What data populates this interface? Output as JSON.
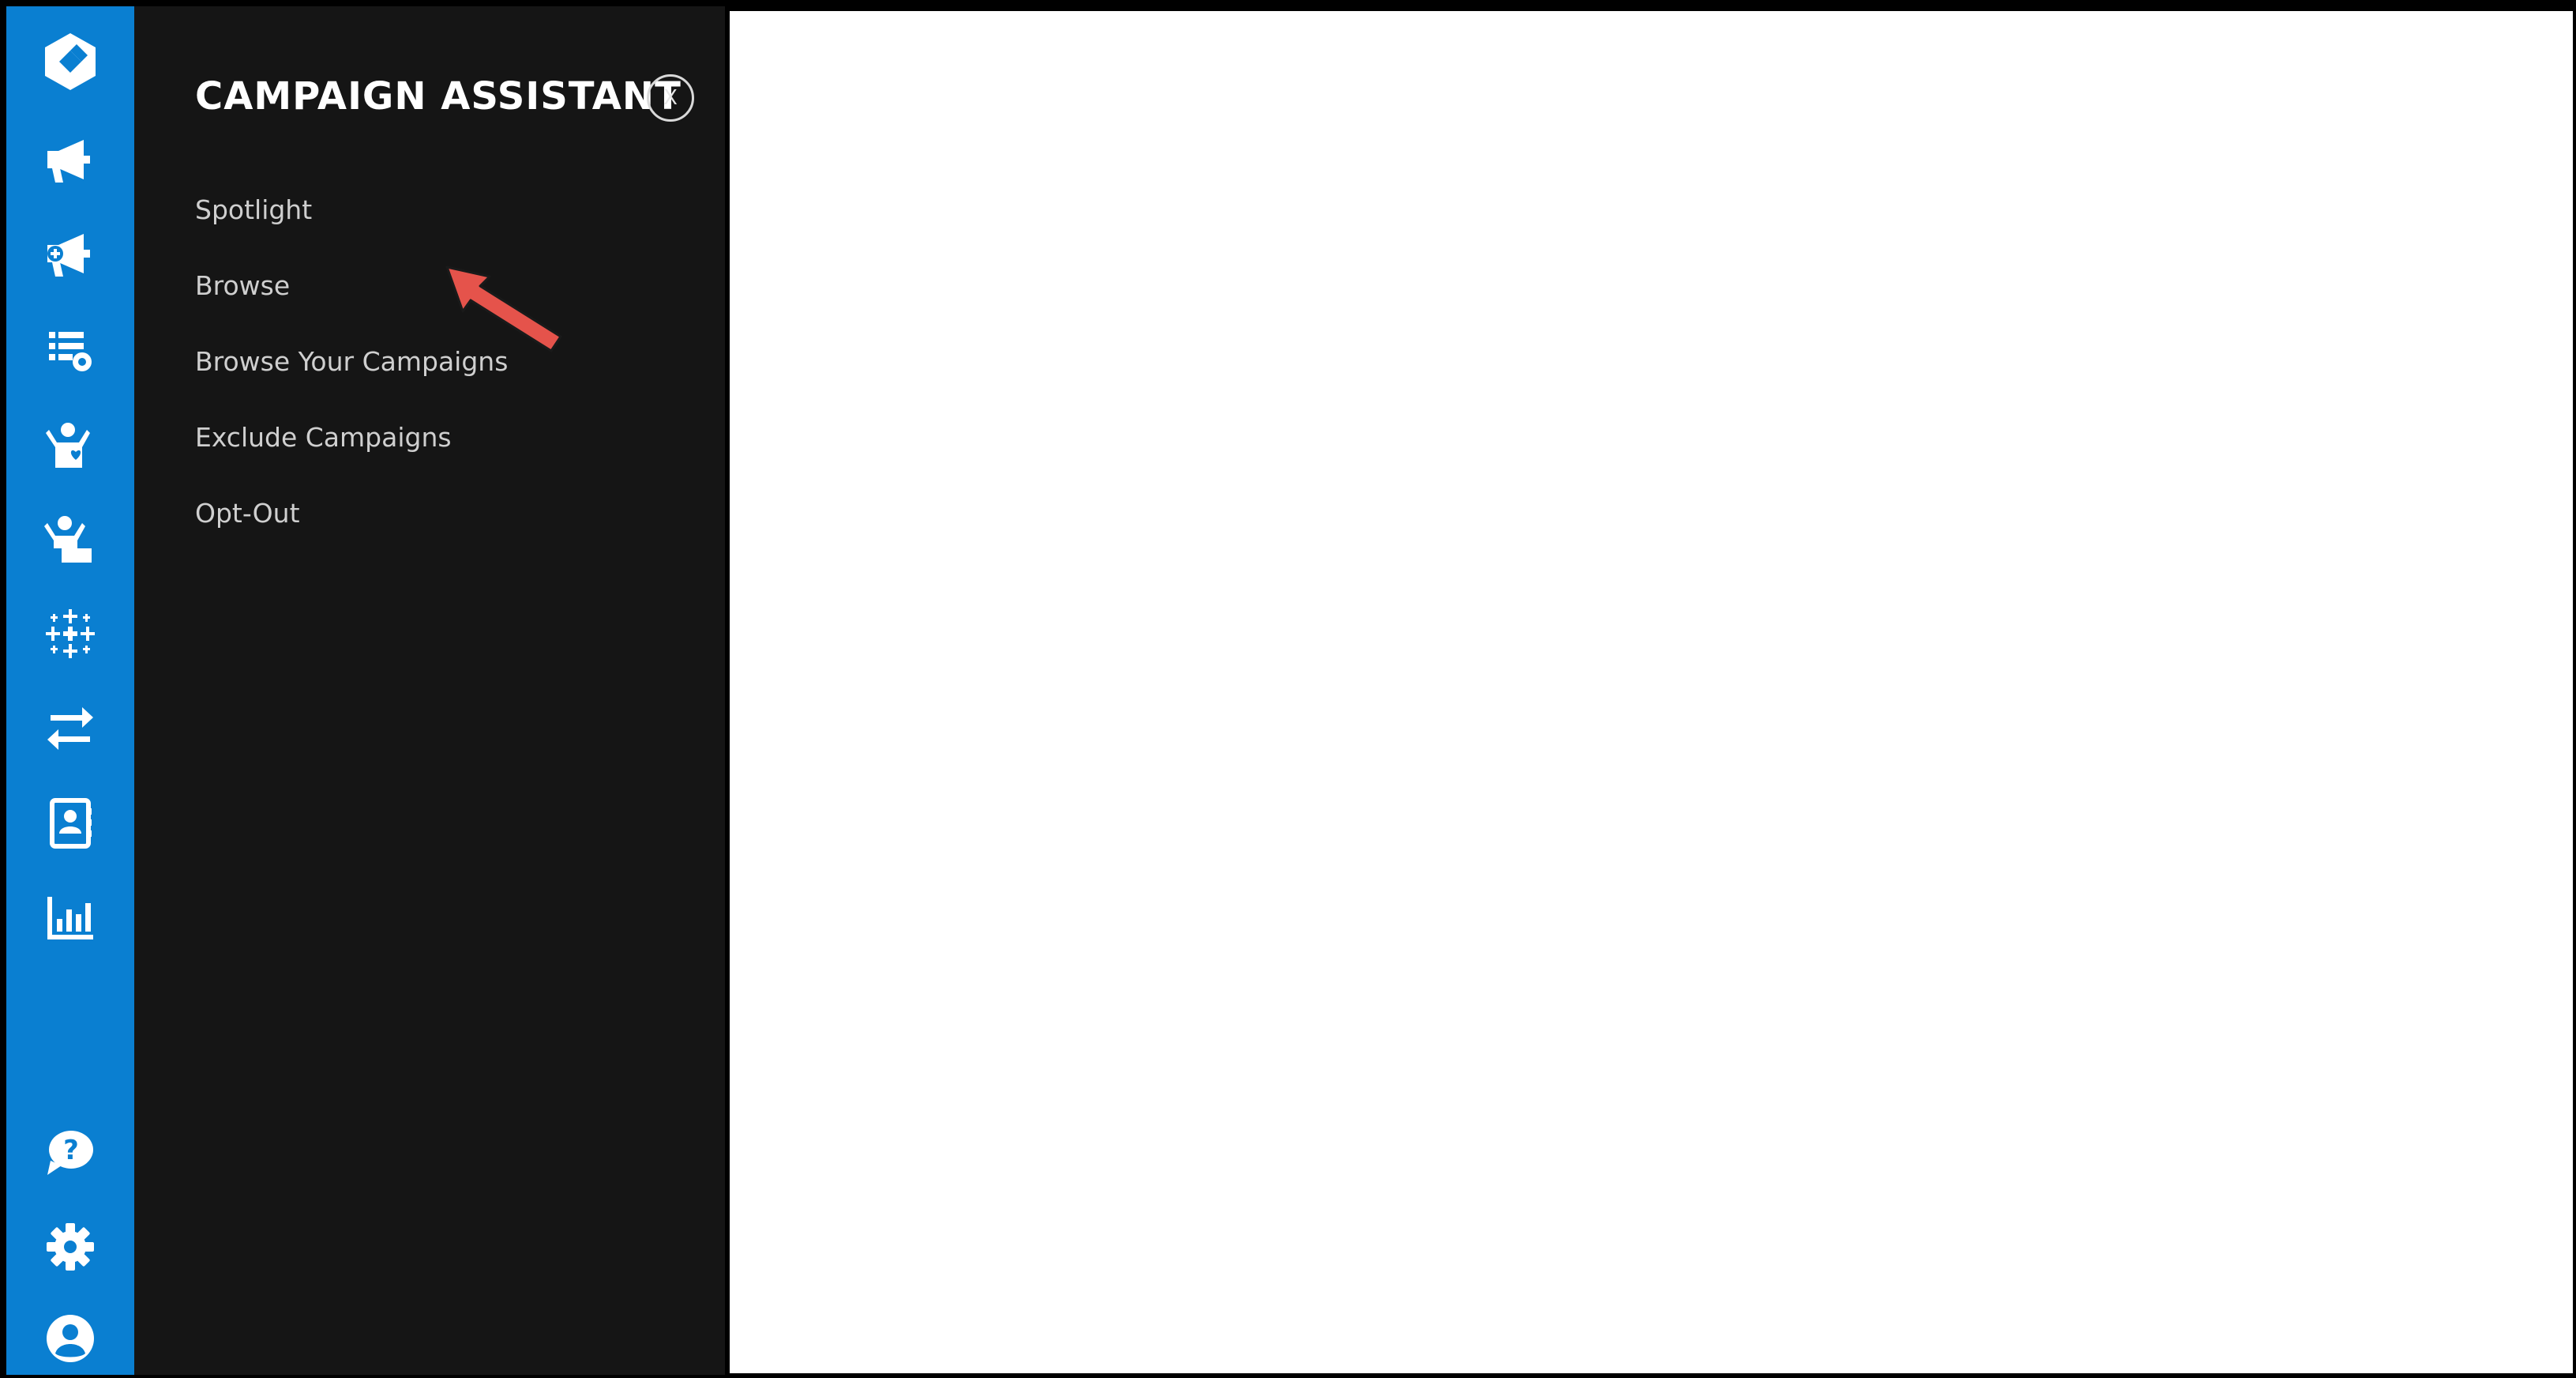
{
  "sidebar": {
    "icons": [
      {
        "name": "app-logo-icon"
      },
      {
        "name": "megaphone-icon"
      },
      {
        "name": "megaphone-add-icon"
      },
      {
        "name": "list-settings-icon"
      },
      {
        "name": "person-heart-icon"
      },
      {
        "name": "person-card-icon"
      },
      {
        "name": "sparkle-grid-icon"
      },
      {
        "name": "transfer-arrows-icon"
      },
      {
        "name": "contact-book-icon"
      },
      {
        "name": "bar-chart-icon"
      },
      {
        "name": "help-chat-icon"
      },
      {
        "name": "gear-icon"
      },
      {
        "name": "user-avatar-icon"
      }
    ],
    "color": "#0a7fd1"
  },
  "panel": {
    "title": "CAMPAIGN ASSISTANT",
    "close_label": "X",
    "items": [
      {
        "label": "Spotlight"
      },
      {
        "label": "Browse"
      },
      {
        "label": "Browse Your Campaigns"
      },
      {
        "label": "Exclude Campaigns"
      },
      {
        "label": "Opt-Out"
      }
    ],
    "background": "#151515"
  },
  "annotation": {
    "arrow_target": "Browse",
    "arrow_color": "#e5534b"
  }
}
